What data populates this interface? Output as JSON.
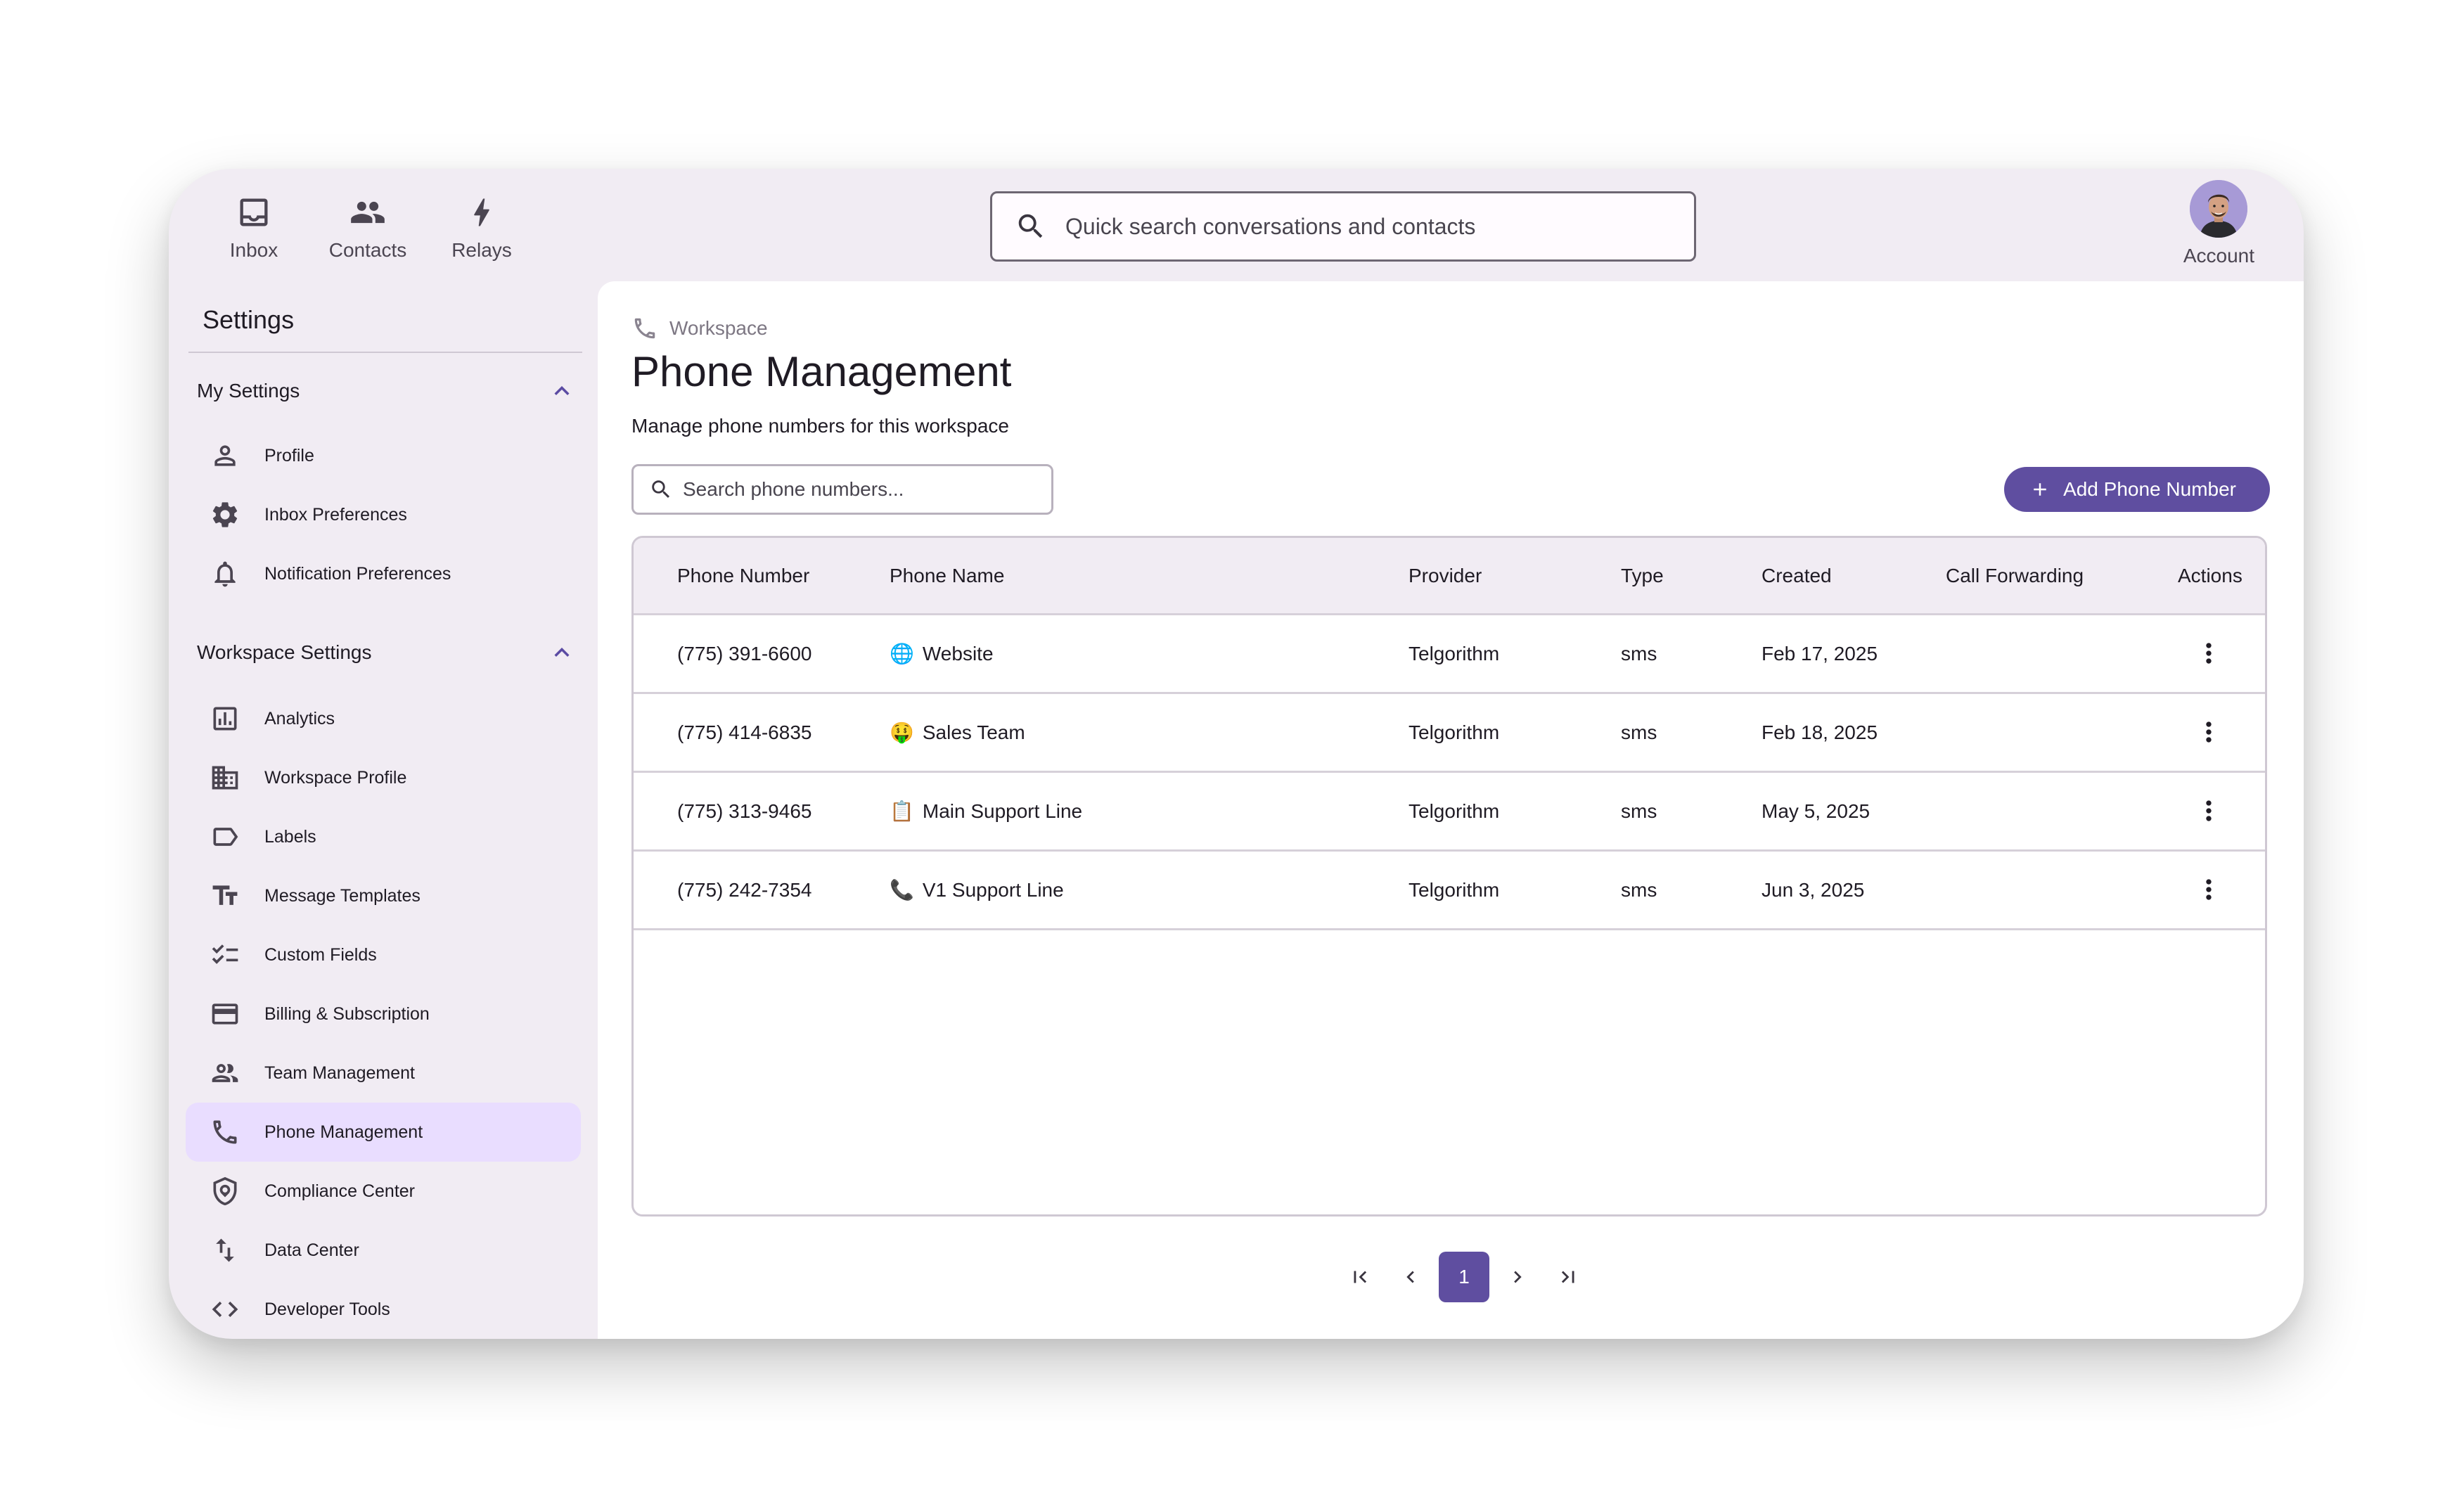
{
  "topnav": {
    "items": [
      {
        "label": "Inbox",
        "icon": "inbox-icon"
      },
      {
        "label": "Contacts",
        "icon": "contacts-icon"
      },
      {
        "label": "Relays",
        "icon": "lightning-icon"
      }
    ],
    "search_placeholder": "Quick search conversations and contacts",
    "account_label": "Account"
  },
  "sidebar": {
    "title": "Settings",
    "groups": [
      {
        "label": "My Settings",
        "expanded": true,
        "items": [
          {
            "label": "Profile",
            "icon": "person-icon"
          },
          {
            "label": "Inbox Preferences",
            "icon": "gear-icon"
          },
          {
            "label": "Notification Preferences",
            "icon": "bell-icon"
          }
        ]
      },
      {
        "label": "Workspace Settings",
        "expanded": true,
        "items": [
          {
            "label": "Analytics",
            "icon": "analytics-icon"
          },
          {
            "label": "Workspace Profile",
            "icon": "building-icon"
          },
          {
            "label": "Labels",
            "icon": "label-icon"
          },
          {
            "label": "Message Templates",
            "icon": "text-fields-icon"
          },
          {
            "label": "Custom Fields",
            "icon": "checklist-icon"
          },
          {
            "label": "Billing & Subscription",
            "icon": "credit-card-icon"
          },
          {
            "label": "Team Management",
            "icon": "team-icon"
          },
          {
            "label": "Phone Management",
            "icon": "phone-icon",
            "active": true
          },
          {
            "label": "Compliance Center",
            "icon": "shield-icon"
          },
          {
            "label": "Data Center",
            "icon": "swap-vertical-icon"
          },
          {
            "label": "Developer Tools",
            "icon": "code-icon"
          }
        ]
      }
    ]
  },
  "main": {
    "breadcrumb": "Workspace",
    "title": "Phone Management",
    "subtitle": "Manage phone numbers for this workspace",
    "search_placeholder": "Search phone numbers...",
    "add_button": "Add Phone Number",
    "table": {
      "columns": [
        "Phone Number",
        "Phone Name",
        "Provider",
        "Type",
        "Created",
        "Call Forwarding",
        "Actions"
      ],
      "rows": [
        {
          "number": "(775) 391-6600",
          "emoji": "🌐",
          "name": "Website",
          "provider": "Telgorithm",
          "type": "sms",
          "created": "Feb 17, 2025",
          "forwarding": ""
        },
        {
          "number": "(775) 414-6835",
          "emoji": "🤑",
          "name": "Sales Team",
          "provider": "Telgorithm",
          "type": "sms",
          "created": "Feb 18, 2025",
          "forwarding": ""
        },
        {
          "number": "(775) 313-9465",
          "emoji": "📋",
          "name": "Main Support Line",
          "provider": "Telgorithm",
          "type": "sms",
          "created": "May 5, 2025",
          "forwarding": ""
        },
        {
          "number": "(775) 242-7354",
          "emoji": "📞",
          "name": "V1 Support Line",
          "provider": "Telgorithm",
          "type": "sms",
          "created": "Jun 3, 2025",
          "forwarding": ""
        }
      ]
    },
    "pagination": {
      "current_page": "1"
    }
  },
  "colors": {
    "accent": "#5f4ea0",
    "app_background": "#f1ecf3",
    "active_item": "#e9ddff"
  }
}
